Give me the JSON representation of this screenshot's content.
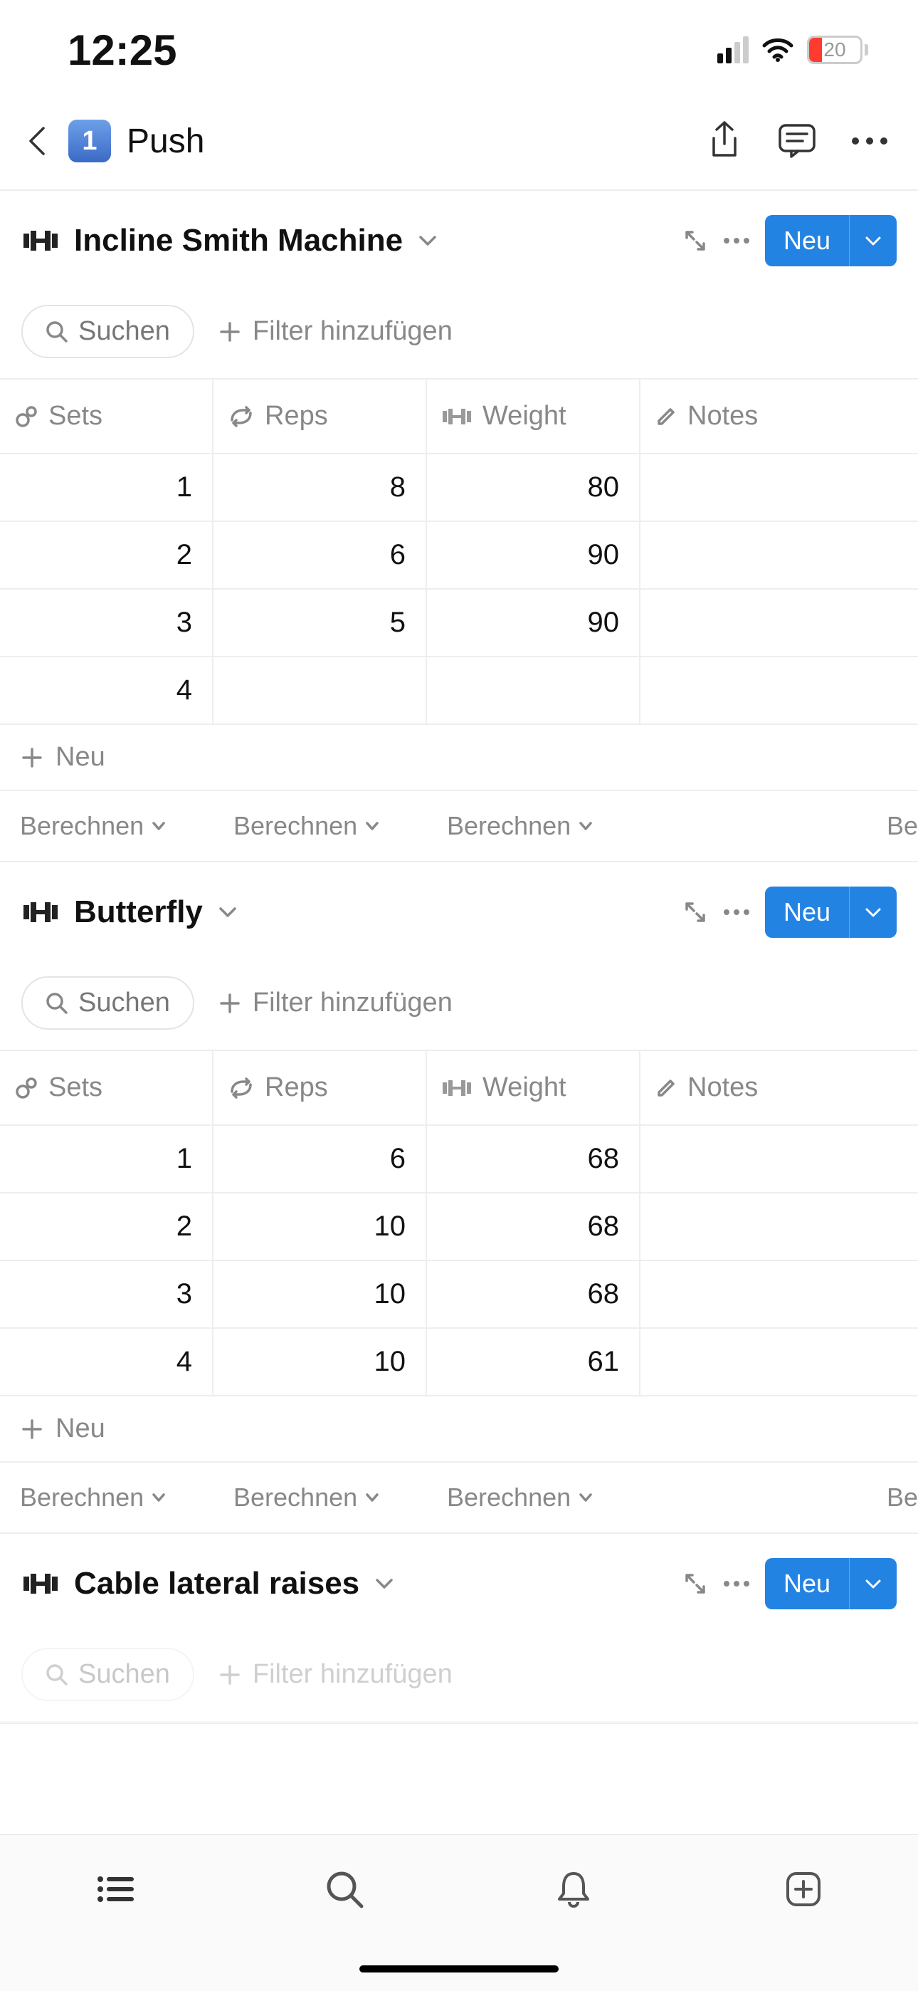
{
  "status": {
    "time": "12:25",
    "battery_pct": "20"
  },
  "nav": {
    "badge": "1",
    "title": "Push"
  },
  "ui": {
    "search_label": "Suchen",
    "add_filter_label": "Filter hinzufügen",
    "new_button_label": "Neu",
    "new_row_label": "Neu",
    "calc_label": "Berechnen",
    "calc_label_truncated": "Be"
  },
  "columns": {
    "sets": "Sets",
    "reps": "Reps",
    "weight": "Weight",
    "notes": "Notes"
  },
  "exercises": [
    {
      "name": "Incline Smith Machine",
      "rows": [
        {
          "sets": "1",
          "reps": "8",
          "weight": "80",
          "notes": ""
        },
        {
          "sets": "2",
          "reps": "6",
          "weight": "90",
          "notes": ""
        },
        {
          "sets": "3",
          "reps": "5",
          "weight": "90",
          "notes": ""
        },
        {
          "sets": "4",
          "reps": "",
          "weight": "",
          "notes": ""
        }
      ]
    },
    {
      "name": "Butterfly",
      "rows": [
        {
          "sets": "1",
          "reps": "6",
          "weight": "68",
          "notes": ""
        },
        {
          "sets": "2",
          "reps": "10",
          "weight": "68",
          "notes": ""
        },
        {
          "sets": "3",
          "reps": "10",
          "weight": "68",
          "notes": ""
        },
        {
          "sets": "4",
          "reps": "10",
          "weight": "61",
          "notes": ""
        }
      ]
    },
    {
      "name": "Cable lateral raises",
      "rows": []
    }
  ]
}
